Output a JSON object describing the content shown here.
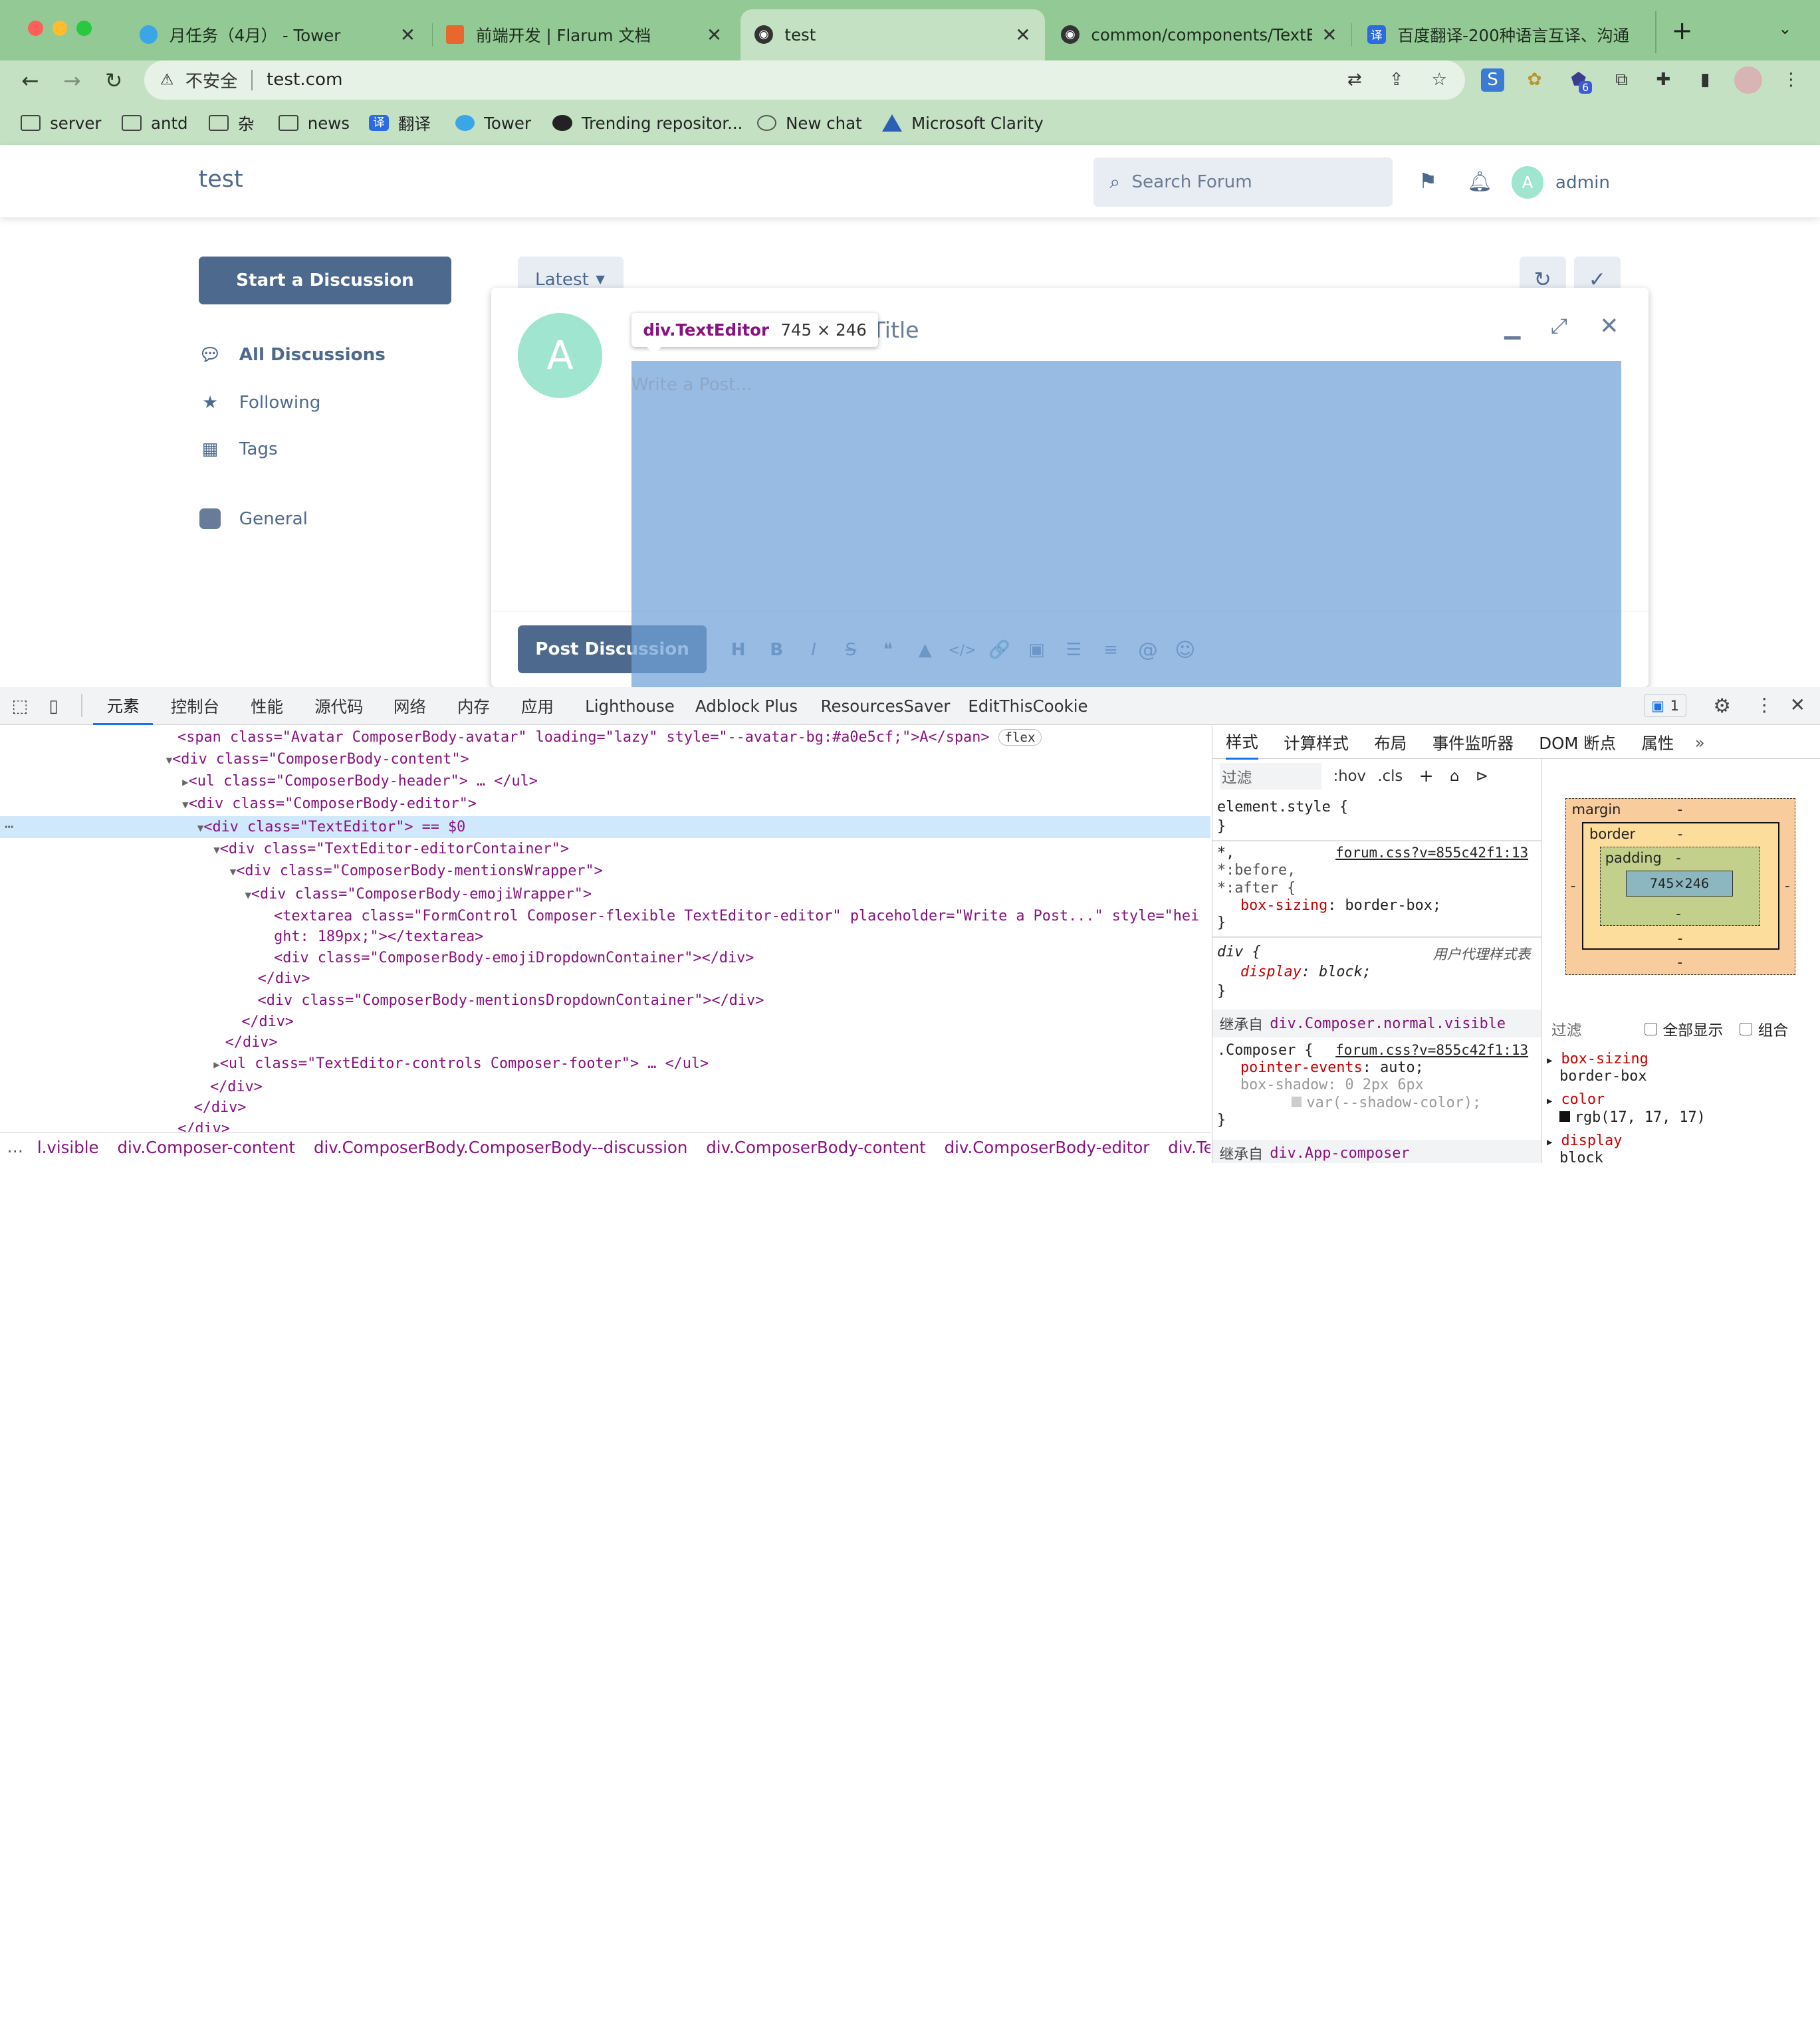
{
  "browser": {
    "tabs": [
      {
        "title": "月任务（4月） - Tower",
        "fav_color": "#3aa6e8"
      },
      {
        "title": "前端开发 | Flarum 文档",
        "fav_color": "#e7672e"
      },
      {
        "title": "test",
        "fav_color": "#333333"
      },
      {
        "title": "common/components/TextEdit",
        "fav_color": "#333333"
      },
      {
        "title": "百度翻译-200种语言互译、沟通",
        "fav_color": "#2b6ae0"
      }
    ],
    "new_tab": "+",
    "address": {
      "security_label": "不安全",
      "url": "test.com"
    },
    "extension_badge": "6",
    "bookmarks": [
      {
        "label": "server",
        "icon": "folder-icon"
      },
      {
        "label": "antd",
        "icon": "folder-icon"
      },
      {
        "label": "杂",
        "icon": "folder-icon"
      },
      {
        "label": "news",
        "icon": "folder-icon"
      },
      {
        "label": "翻译",
        "icon": "translate-icon"
      },
      {
        "label": "Tower",
        "icon": "tower-icon"
      },
      {
        "label": "Trending repositor...",
        "icon": "github-icon"
      },
      {
        "label": "New chat",
        "icon": "openai-icon"
      },
      {
        "label": "Microsoft Clarity",
        "icon": "clarity-icon"
      }
    ]
  },
  "forum": {
    "title": "test",
    "search_placeholder": "Search Forum",
    "user": {
      "avatar_letter": "A",
      "name": "admin"
    },
    "start_discussion": "Start a Discussion",
    "nav": [
      {
        "label": "All Discussions",
        "icon": "comments-icon"
      },
      {
        "label": "Following",
        "icon": "star-icon"
      },
      {
        "label": "Tags",
        "icon": "tags-icon"
      },
      {
        "label": "General",
        "icon": "tag-square-icon"
      }
    ],
    "sort_label": "Latest",
    "composer": {
      "avatar_letter": "A",
      "title_placeholder": "Discussion Title",
      "title_visible": "n Title",
      "post_placeholder": "Write a Post...",
      "post_button": "Post Discussion",
      "controls": [
        "H",
        "B",
        "I",
        "S",
        "❝",
        "▲",
        "</>",
        "🔗",
        "▣",
        "☰",
        "≡",
        "@",
        "☺"
      ]
    },
    "inspect_tooltip": {
      "tag": "div.TextEditor",
      "size": "745 × 246"
    }
  },
  "devtools": {
    "tabs": [
      "元素",
      "控制台",
      "性能",
      "源代码",
      "网络",
      "内存",
      "应用",
      "Lighthouse",
      "Adblock Plus",
      "ResourcesSaver",
      "EditThisCookie"
    ],
    "issues_count": "1",
    "dom_lines": [
      "<span class=\"Avatar ComposerBody-avatar\" loading=\"lazy\" style=\"--avatar-bg:#a0e5cf;\">A</span>",
      "<div class=\"ComposerBody-content\">",
      "<ul class=\"ComposerBody-header\"> … </ul>",
      "<div class=\"ComposerBody-editor\">",
      "<div class=\"TextEditor\"> == $0",
      "<div class=\"TextEditor-editorContainer\">",
      "<div class=\"ComposerBody-mentionsWrapper\">",
      "<div class=\"ComposerBody-emojiWrapper\">",
      "<textarea class=\"FormControl Composer-flexible TextEditor-editor\" placeholder=\"Write a Post...\" style=\"hei",
      "ght: 189px;\"></textarea>",
      "<div class=\"ComposerBody-emojiDropdownContainer\"></div>",
      "</div>",
      "<div class=\"ComposerBody-mentionsDropdownContainer\"></div>",
      "</div>",
      "</div>",
      "<ul class=\"TextEditor-controls Composer-footer\"> … </ul>",
      "</div>",
      "</div>",
      "</div>"
    ],
    "flex_badge": "flex",
    "breadcrumb": [
      "l.visible",
      "div.Composer-content",
      "div.ComposerBody.ComposerBody--discussion",
      "div.ComposerBody-content",
      "div.ComposerBody-editor",
      "div.TextEditor",
      "…"
    ],
    "styles_tabs": [
      "样式",
      "计算样式",
      "布局",
      "事件监听器",
      "DOM 断点",
      "属性",
      "»"
    ],
    "styles_filter": "过滤",
    "hov": ":hov",
    "cls": ".cls",
    "rules": {
      "element_style": "element.style {",
      "close": "}",
      "universal_sel_1": "*,",
      "universal_sel_2": "*:before,",
      "universal_sel_3": "*:after {",
      "source": "forum.css?v=855c42f1:13",
      "box_sizing_prop": "box-sizing",
      "box_sizing_val": "border-box;",
      "div_sel": "div {",
      "ua_label": "用户代理样式表",
      "display_prop": "display",
      "display_val": "block;",
      "inherited_1_label": "继承自",
      "inherited_1_sel": "div.Composer.normal.visible",
      "composer_sel": ".Composer {",
      "pe_prop": "pointer-events",
      "pe_val": "auto;",
      "bs_prop": "box-shadow",
      "bs_val": "0 2px 6px",
      "bs_var": "var(--shadow-color);",
      "inherited_2_label": "继承自",
      "inherited_2_sel": "div.App-composer"
    },
    "box_model": {
      "margin": "margin",
      "border": "border",
      "padding": "padding",
      "content": "745×246",
      "dash": "-"
    },
    "computed": {
      "filter": "过滤",
      "show_all": "全部显示",
      "group": "组合",
      "props": [
        {
          "name": "box-sizing",
          "value": "border-box"
        },
        {
          "name": "color",
          "value": "rgb(17, 17, 17)"
        },
        {
          "name": "display",
          "value": "block"
        }
      ]
    }
  }
}
